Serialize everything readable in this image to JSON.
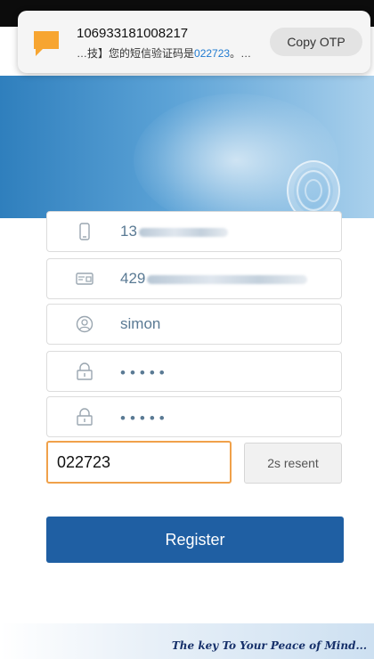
{
  "notification": {
    "sender": "106933181008217",
    "message_prefix": "…技】您的短信验证码是",
    "message_code": "022723",
    "message_suffix": "。…",
    "copy_button_label": "Copy OTP"
  },
  "form": {
    "phone_prefix": "13",
    "id_prefix": "429",
    "username": "simon",
    "password_mask": "•••••",
    "confirm_password_mask": "•••••",
    "otp_value": "022723",
    "resend_label": "2s resent",
    "register_label": "Register"
  },
  "footer": {
    "tagline": "The key To Your Peace of Mind..."
  },
  "colors": {
    "brand_blue": "#1f5fa3",
    "otp_border": "#f0a14a",
    "hero_blue": "#2f7fbd"
  },
  "icons": [
    "message-icon",
    "phone-icon",
    "id-card-icon",
    "user-icon",
    "lock-icon",
    "lock-icon"
  ]
}
